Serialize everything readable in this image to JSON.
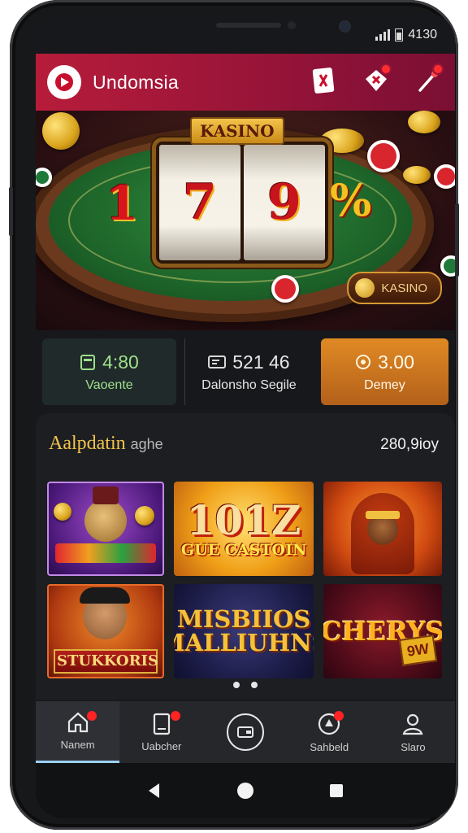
{
  "status_bar": {
    "time": "4130"
  },
  "app_bar": {
    "title": "Undomsia",
    "icons": [
      "card-icon",
      "dice-icon",
      "wand-icon"
    ]
  },
  "hero": {
    "sign": "KASINO",
    "reels": [
      "7",
      "9",
      "%"
    ],
    "left_symbol": "1",
    "button_label": "KASINO"
  },
  "stats": [
    {
      "value": "4:80",
      "label": "Vaoente"
    },
    {
      "value": "521  46",
      "label": "Dalonsho Segile"
    },
    {
      "value": "3.00",
      "label": "Demey"
    }
  ],
  "games_section": {
    "title": "Aalpdatin",
    "subtitle": "aghe",
    "count": "280,9ioy",
    "tiles": [
      {
        "title": ""
      },
      {
        "title_big": "101Z",
        "title_small": "GUE CASTOIN"
      },
      {
        "title": ""
      },
      {
        "title": "STUKKORIS"
      },
      {
        "title": "MISBIIOS MALLIUHNS"
      },
      {
        "title": "CHERYS",
        "tag": "9W"
      }
    ]
  },
  "tab_bar": {
    "items": [
      {
        "label": "Nanem",
        "icon": "home-icon"
      },
      {
        "label": "Uabcher",
        "icon": "document-icon"
      },
      {
        "label": "",
        "icon": "wallet-icon"
      },
      {
        "label": "Sahbeld",
        "icon": "gift-icon"
      },
      {
        "label": "Slaro",
        "icon": "profile-icon"
      }
    ]
  },
  "colors": {
    "accent": "#b71c3a",
    "gold": "#f2c44a",
    "orange": "#e08a24"
  }
}
